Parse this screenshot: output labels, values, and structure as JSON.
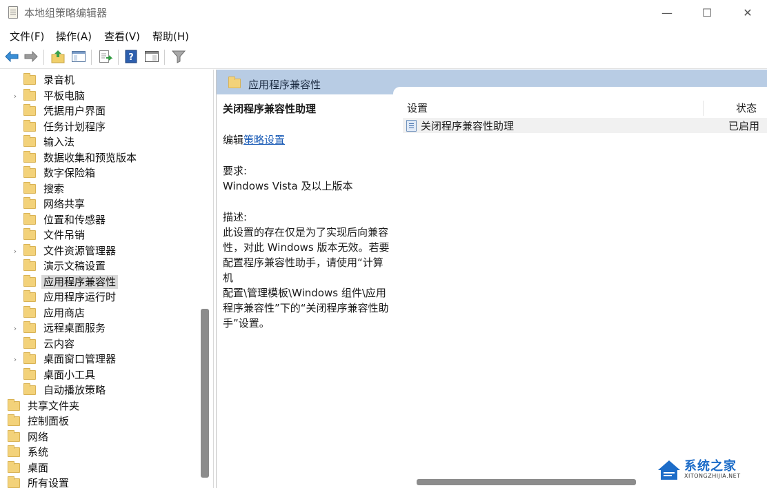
{
  "window": {
    "title": "本地组策略编辑器",
    "minimize": "—",
    "maximize": "☐",
    "close": "✕"
  },
  "menu": [
    "文件(F)",
    "操作(A)",
    "查看(V)",
    "帮助(H)"
  ],
  "toolbar": {
    "icons": [
      "back-arrow-icon",
      "forward-arrow-icon",
      "up-folder-icon",
      "show-hide-tree-icon",
      "export-list-icon",
      "help-icon",
      "properties-icon",
      "filter-icon"
    ]
  },
  "tree": {
    "items": [
      {
        "label": "录音机",
        "expandable": false
      },
      {
        "label": "平板电脑",
        "expandable": true
      },
      {
        "label": "凭据用户界面",
        "expandable": false
      },
      {
        "label": "任务计划程序",
        "expandable": false
      },
      {
        "label": "输入法",
        "expandable": false
      },
      {
        "label": "数据收集和预览版本",
        "expandable": false
      },
      {
        "label": "数字保险箱",
        "expandable": false
      },
      {
        "label": "搜索",
        "expandable": false
      },
      {
        "label": "网络共享",
        "expandable": false
      },
      {
        "label": "位置和传感器",
        "expandable": false
      },
      {
        "label": "文件吊销",
        "expandable": false
      },
      {
        "label": "文件资源管理器",
        "expandable": true
      },
      {
        "label": "演示文稿设置",
        "expandable": false
      },
      {
        "label": "应用程序兼容性",
        "expandable": false,
        "selected": true
      },
      {
        "label": "应用程序运行时",
        "expandable": false
      },
      {
        "label": "应用商店",
        "expandable": false
      },
      {
        "label": "远程桌面服务",
        "expandable": true
      },
      {
        "label": "云内容",
        "expandable": false
      },
      {
        "label": "桌面窗口管理器",
        "expandable": true
      },
      {
        "label": "桌面小工具",
        "expandable": false
      },
      {
        "label": "自动播放策略",
        "expandable": false
      }
    ],
    "top_items": [
      {
        "label": "共享文件夹"
      },
      {
        "label": "控制面板"
      },
      {
        "label": "网络"
      },
      {
        "label": "系统"
      },
      {
        "label": "桌面"
      },
      {
        "label": "所有设置"
      }
    ]
  },
  "category": {
    "title": "应用程序兼容性"
  },
  "description": {
    "title": "关闭程序兼容性助理",
    "edit_prefix": "编辑",
    "edit_link": "策略设置",
    "requirement_label": "要求:",
    "requirement_value": "Windows Vista 及以上版本",
    "desc_label": "描述:",
    "desc_lines": [
      "此设置的存在仅是为了实现后向兼容",
      "性，对此 Windows 版本无效。若要",
      "配置程序兼容性助手，请使用“计算机",
      "配置\\管理模板\\Windows 组件\\应用",
      "程序兼容性”下的“关闭程序兼容性助",
      "手”设置。"
    ]
  },
  "list": {
    "col_setting": "设置",
    "col_state": "状态",
    "rows": [
      {
        "name": "关闭程序兼容性助理",
        "state": "已启用"
      }
    ]
  },
  "watermark": {
    "text": "系统之家",
    "sub": "XITONGZHIJIA.NET"
  },
  "colors": {
    "category_header": "#b8cce4",
    "link": "#1f5fb8",
    "folder": "#f3d27a"
  }
}
